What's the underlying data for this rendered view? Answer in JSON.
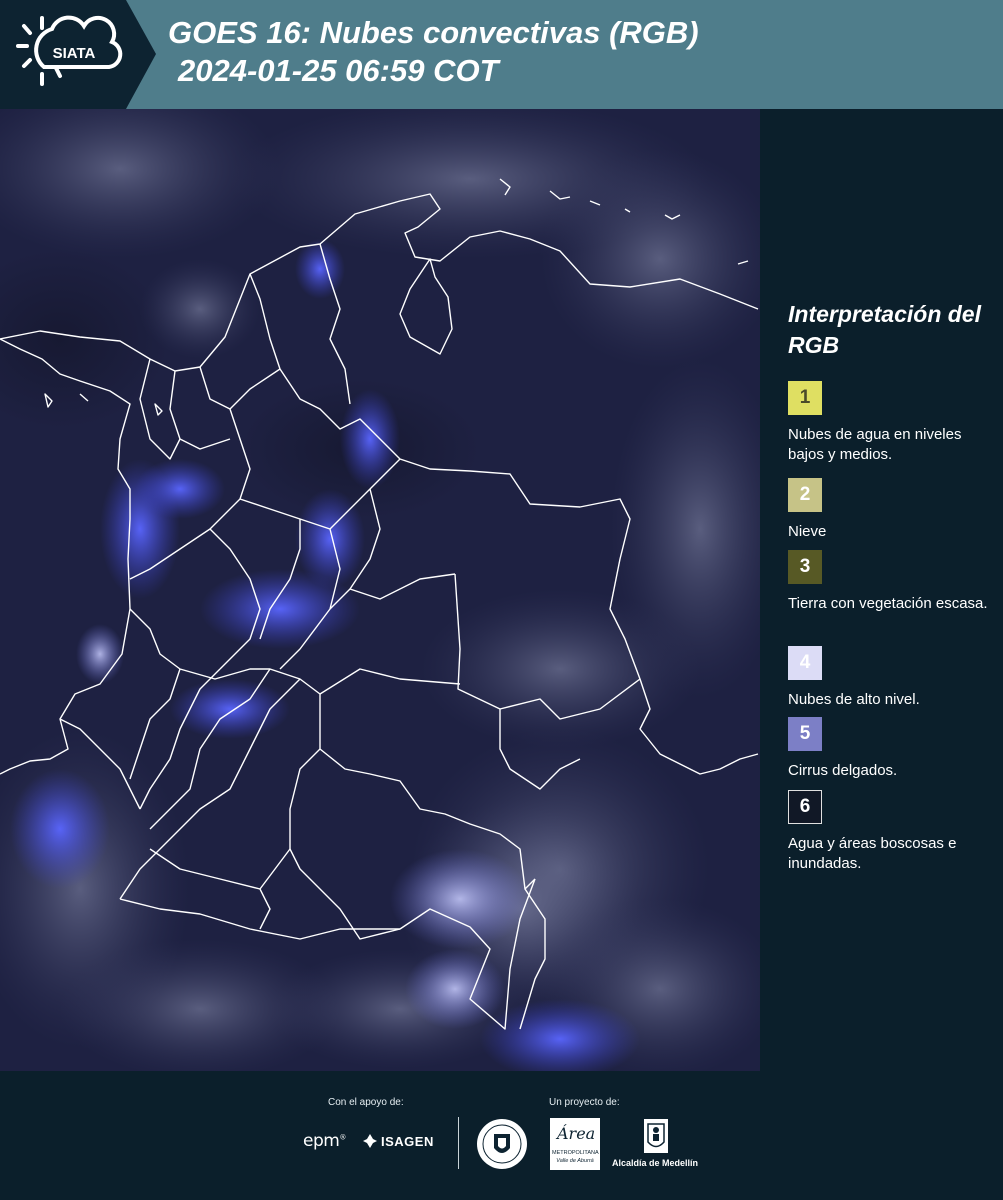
{
  "header": {
    "logo_text": "SIATA",
    "title_line1": "GOES 16: Nubes convectivas (RGB)",
    "title_line2": "2024-01-25 06:59 COT"
  },
  "map": {
    "product": "GOES 16 convective clouds RGB composite",
    "region": "Colombia",
    "colors": {
      "background": "#1c1e3e",
      "boundary": "#ffffff",
      "cloud_blue": "#4c5cf0",
      "cloud_gray": "#8a8fa8"
    }
  },
  "legend": {
    "title": "Interpretación del RGB",
    "items": [
      {
        "number": "1",
        "label": "Nubes de agua en niveles bajos y medios.",
        "color": "#dfdf62",
        "text_color": "#4a4a2a"
      },
      {
        "number": "2",
        "label": "Nieve",
        "color": "#c6c387",
        "text_color": "#ffffff"
      },
      {
        "number": "3",
        "label": "Tierra con vegetación escasa.",
        "color": "#575925",
        "text_color": "#ffffff"
      },
      {
        "number": "4",
        "label": "Nubes de alto nivel.",
        "color": "#dcdcf6",
        "text_color": "#ffffff"
      },
      {
        "number": "5",
        "label": "Cirrus delgados.",
        "color": "#7c7fc6",
        "text_color": "#ffffff"
      },
      {
        "number": "6",
        "label": "Agua y áreas boscosas e inundadas.",
        "color": "#111826",
        "text_color": "#ffffff",
        "border": "#e0e0e0"
      }
    ]
  },
  "footer": {
    "support_caption": "Con el apoyo de:",
    "project_caption": "Un proyecto de:",
    "epm": "epm",
    "isagen": "ISAGEN",
    "area_script": "Área",
    "area_sub1": "METROPOLITANA",
    "area_sub2": "Valle de Aburrá",
    "alcaldia": "Alcaldía de Medellín"
  }
}
